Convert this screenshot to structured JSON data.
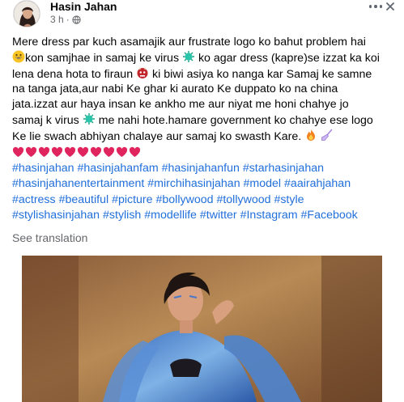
{
  "post": {
    "author": "Hasin Jahan",
    "time": "3 h",
    "separator": "·",
    "privacy_icon": "globe-icon",
    "more_icon": "more-options-icon",
    "close_icon": "close-icon",
    "body_lines": [
      "Mere dress par kuch asamajik aur frustrate logo ko bahut problem hai",
      "kon samjhae in samaj ke virus",
      "ko agar dress (kapre)se izzat ka koi",
      "lena dena hota to firaun",
      "ki biwi asiya ko nanga kar Samaj ke samne",
      "na tanga jata,aur nabi Ke ghar ki aurato Ke duppato ko na china",
      "jata.izzat aur haya insan ke ankho me aur niyat me honi chahye jo",
      "samaj k virus",
      "me nahi hote.hamare government ko chahye ese logo",
      "Ke lie swach abhiyan chalaye aur samaj ko swasth Kare."
    ],
    "heart_count": 10,
    "hashtags": [
      [
        "#hasinjahan",
        "#hasinjahanfam",
        "#hasinjahanfun",
        "#starhasinjahan"
      ],
      [
        "#hasinjahanentertainment",
        "#mirchihasinjahan",
        "#model",
        "#aairahjahan"
      ],
      [
        "#actress",
        "#beautiful",
        "#picture",
        "#bollywood",
        "#tollywood",
        "#style"
      ],
      [
        "#stylishasinjahan",
        "#stylish",
        "#modellife",
        "#twitter",
        "#Instagram",
        "#Facebook"
      ]
    ],
    "see_translation": "See translation"
  },
  "colors": {
    "hashtag": "#216fdb",
    "secondary_text": "#65676b",
    "heart": "#e0245e"
  }
}
